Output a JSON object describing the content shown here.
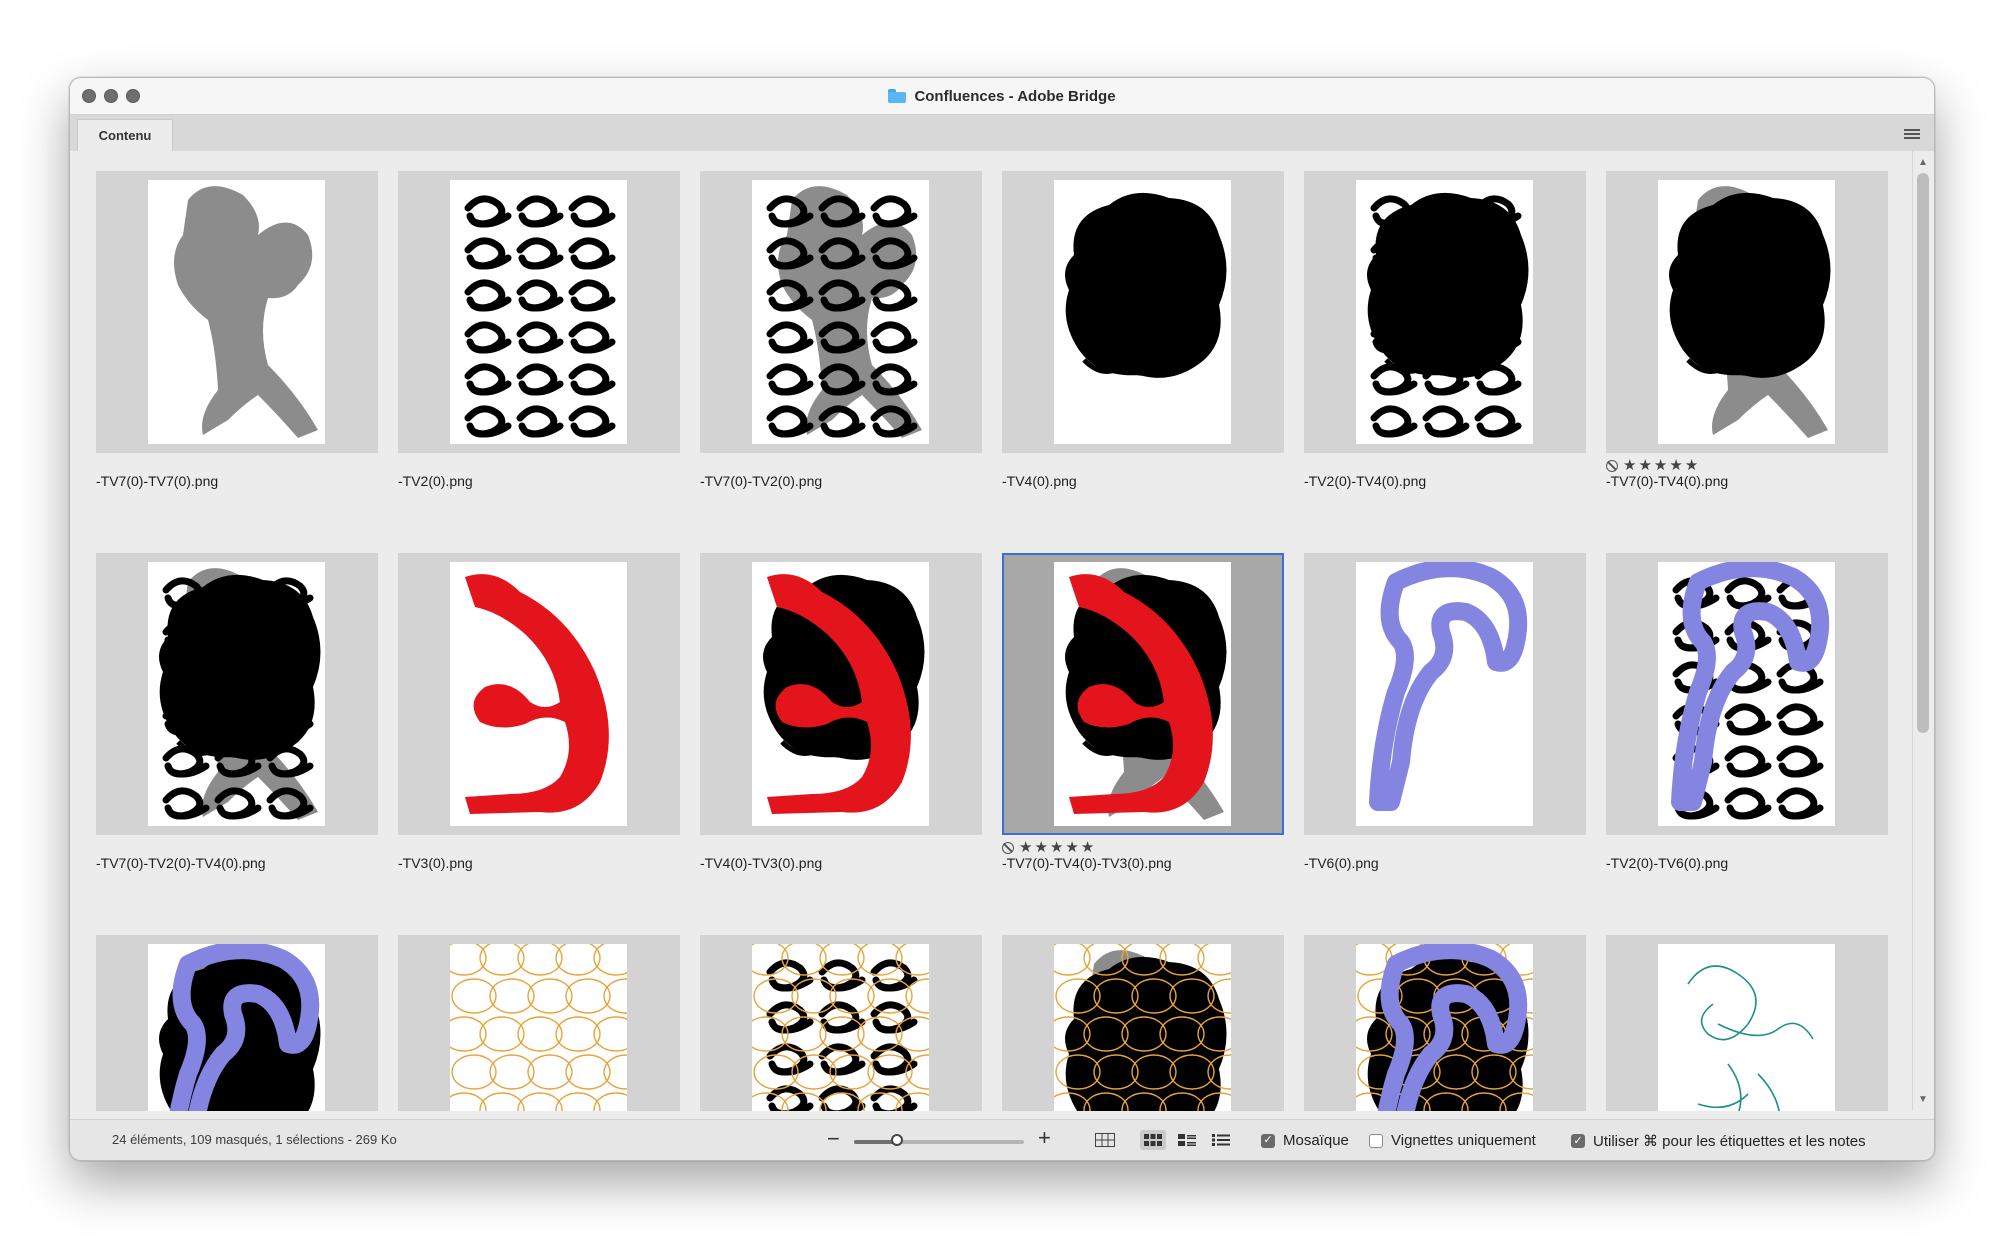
{
  "window": {
    "title": "Confluences - Adobe Bridge"
  },
  "tabs": [
    {
      "label": "Contenu"
    }
  ],
  "items": [
    {
      "name": "-TV7(0)-TV7(0).png",
      "rated": false,
      "layers": [
        "grey"
      ]
    },
    {
      "name": "-TV2(0).png",
      "rated": false,
      "layers": [
        "glyphs"
      ]
    },
    {
      "name": "-TV7(0)-TV2(0).png",
      "rated": false,
      "layers": [
        "grey",
        "glyphs"
      ]
    },
    {
      "name": "-TV4(0).png",
      "rated": false,
      "layers": [
        "blob"
      ]
    },
    {
      "name": "-TV2(0)-TV4(0).png",
      "rated": false,
      "layers": [
        "glyphs",
        "blob"
      ]
    },
    {
      "name": "-TV7(0)-TV4(0).png",
      "rated": true,
      "stars": 5,
      "layers": [
        "grey",
        "blob"
      ]
    },
    {
      "name": "-TV7(0)-TV2(0)-TV4(0).png",
      "rated": false,
      "layers": [
        "grey",
        "glyphs",
        "blob"
      ]
    },
    {
      "name": "-TV3(0).png",
      "rated": false,
      "layers": [
        "red"
      ]
    },
    {
      "name": "-TV4(0)-TV3(0).png",
      "rated": false,
      "layers": [
        "blob",
        "red"
      ]
    },
    {
      "name": "-TV7(0)-TV4(0)-TV3(0).png",
      "rated": true,
      "stars": 5,
      "selected": true,
      "layers": [
        "grey",
        "blob",
        "red"
      ]
    },
    {
      "name": "-TV6(0).png",
      "rated": false,
      "layers": [
        "purple"
      ]
    },
    {
      "name": "-TV2(0)-TV6(0).png",
      "rated": false,
      "layers": [
        "glyphs",
        "purple"
      ]
    },
    {
      "name": "",
      "rated": false,
      "layers": [
        "grey",
        "blob",
        "purple"
      ]
    },
    {
      "name": "",
      "rated": false,
      "layers": [
        "orange"
      ]
    },
    {
      "name": "",
      "rated": false,
      "layers": [
        "glyphs",
        "orange"
      ]
    },
    {
      "name": "",
      "rated": false,
      "layers": [
        "grey",
        "blob",
        "orange"
      ]
    },
    {
      "name": "",
      "rated": false,
      "layers": [
        "blob",
        "orange",
        "purple"
      ]
    },
    {
      "name": "",
      "rated": false,
      "layers": [
        "teal"
      ]
    }
  ],
  "status": {
    "text": "24 éléments, 109 masqués, 1 sélections - 269 Ko"
  },
  "zoom": {
    "level": 0.25,
    "minus": "−",
    "plus": "+"
  },
  "view_modes": [
    {
      "icon": "grid-lock-icon",
      "active": false
    },
    {
      "icon": "thumbnail-view-icon",
      "active": true
    },
    {
      "icon": "details-view-icon",
      "active": false
    },
    {
      "icon": "list-view-icon",
      "active": false
    }
  ],
  "options": {
    "mosaic": {
      "label": "Mosaïque",
      "checked": true
    },
    "thumbs_only": {
      "label": "Vignettes uniquement",
      "checked": false
    },
    "use_cmd": {
      "label": "Utiliser ⌘ pour les étiquettes et les notes",
      "checked": true
    }
  },
  "colors": {
    "selection": "#3b6fd4",
    "grey_figure": "#8c8c8c",
    "red": "#e3141b",
    "purple": "#8485e0",
    "orange": "#e8a33b",
    "teal": "#1f8f8f"
  },
  "rating_star": "★"
}
